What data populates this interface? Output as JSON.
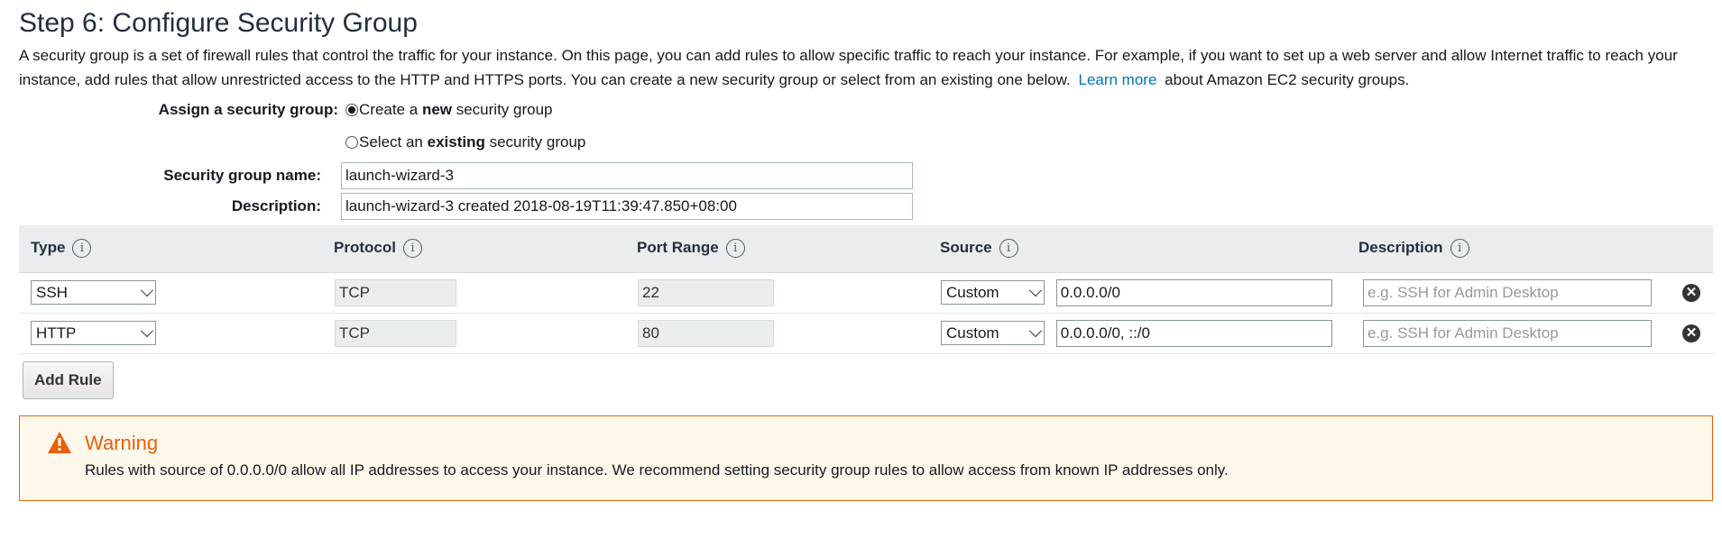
{
  "page": {
    "title": "Step 6: Configure Security Group",
    "intro_before_link": "A security group is a set of firewall rules that control the traffic for your instance. On this page, you can add rules to allow specific traffic to reach your instance. For example, if you want to set up a web server and allow Internet traffic to reach your instance, add rules that allow unrestricted access to the HTTP and HTTPS ports. You can create a new security group or select from an existing one below.",
    "learn_more": "Learn more",
    "intro_after_link": "about Amazon EC2 security groups."
  },
  "assign": {
    "label": "Assign a security group:",
    "create_prefix": "Create a ",
    "create_bold": "new",
    "create_suffix": " security group",
    "select_prefix": "Select an ",
    "select_bold": "existing",
    "select_suffix": " security group",
    "selected": "create"
  },
  "group": {
    "name_label": "Security group name:",
    "name_value": "launch-wizard-3",
    "desc_label": "Description:",
    "desc_value": "launch-wizard-3 created 2018-08-19T11:39:47.850+08:00"
  },
  "table": {
    "headers": {
      "type": "Type",
      "protocol": "Protocol",
      "port_range": "Port Range",
      "source": "Source",
      "description": "Description"
    },
    "info_glyph": "i",
    "rows": [
      {
        "type": "SSH",
        "protocol": "TCP",
        "port": "22",
        "source_mode": "Custom",
        "source": "0.0.0.0/0",
        "desc_placeholder": "e.g. SSH for Admin Desktop"
      },
      {
        "type": "HTTP",
        "protocol": "TCP",
        "port": "80",
        "source_mode": "Custom",
        "source": "0.0.0.0/0, ::/0",
        "desc_placeholder": "e.g. SSH for Admin Desktop"
      }
    ],
    "remove_glyph": "✕"
  },
  "add_rule_label": "Add Rule",
  "warning": {
    "title": "Warning",
    "text": "Rules with source of 0.0.0.0/0 allow all IP addresses to access your instance. We recommend setting security group rules to allow access from known IP addresses only.",
    "color": "#eb5f07"
  },
  "colors": {
    "link": "#0073bb",
    "header_bg": "#eaeded",
    "warning_bg": "#fef8eb"
  }
}
